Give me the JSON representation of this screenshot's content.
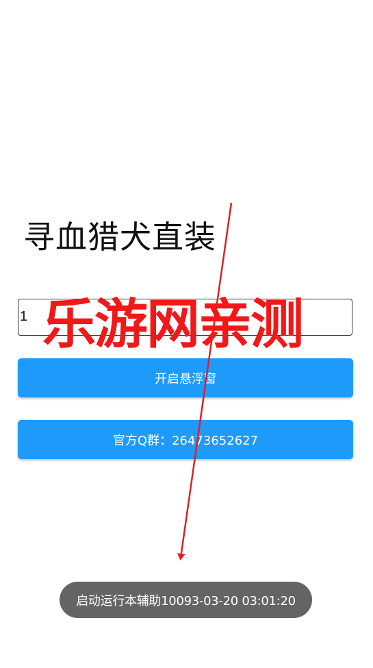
{
  "app": {
    "title": "寻血猎犬直装"
  },
  "input": {
    "value": "1"
  },
  "buttons": {
    "floating_window": "开启悬浮窗",
    "qq_group": "官方Q群：2647365262 7"
  },
  "watermark": {
    "text": "乐游网亲测",
    "color": "#f01818"
  },
  "toast": {
    "message": "启动运行本辅助10093-03-20 03:01:20"
  },
  "colors": {
    "button": "#1e9bfa",
    "toast_bg": "#646464",
    "arrow": "#e02020"
  }
}
